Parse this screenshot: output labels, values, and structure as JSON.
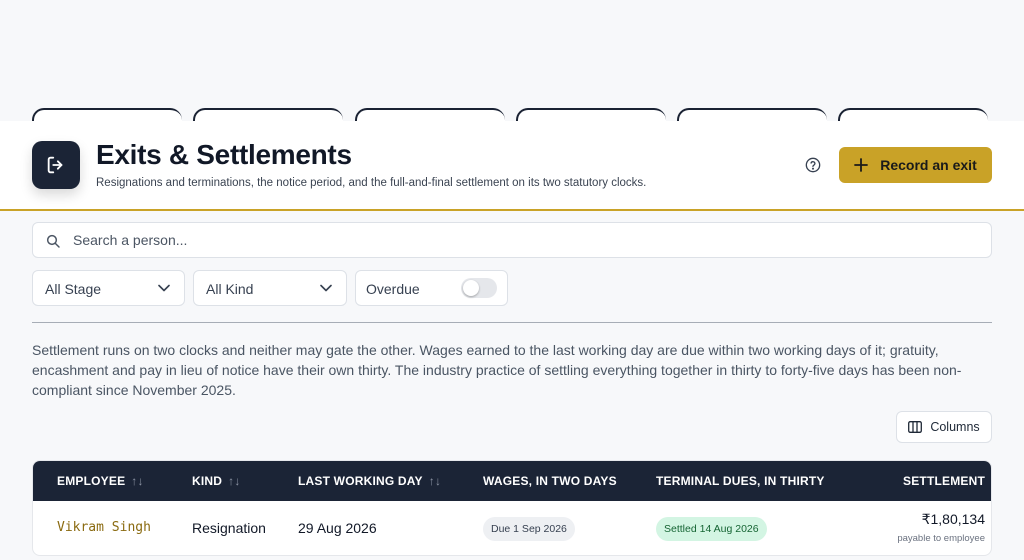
{
  "header": {
    "title": "Exits & Settlements",
    "subtitle": "Resignations and terminations, the notice period, and the full-and-final settlement on its two statutory clocks.",
    "logo_icon": "exit-door-icon",
    "help_icon": "help-circle-icon",
    "primary_action": {
      "label": "Record an exit",
      "icon": "plus-icon"
    }
  },
  "search": {
    "placeholder": "Search a person...",
    "value": ""
  },
  "filters": {
    "stage": {
      "selected": "All Stage"
    },
    "kind": {
      "selected": "All Kind"
    },
    "overdue": {
      "label": "Overdue",
      "on": false
    }
  },
  "notice": "Settlement runs on two clocks and neither may gate the other. Wages earned to the last working day are due within two working days of it; gratuity, encashment and pay in lieu of notice have their own thirty. The industry practice of settling everything together in thirty to forty-five days has been non-compliant since November 2025.",
  "columns_button": {
    "label": "Columns",
    "icon": "columns-icon"
  },
  "table": {
    "headers": {
      "employee": "EMPLOYEE",
      "kind": "KIND",
      "last_working_day": "LAST WORKING DAY",
      "wages": "WAGES, IN TWO DAYS",
      "terminal": "TERMINAL DUES, IN THIRTY",
      "settlement": "SETTLEMENT"
    },
    "sort_glyph": "↑↓",
    "rows": [
      {
        "employee": "Vikram Singh",
        "kind": "Resignation",
        "last_working_day": "29 Aug 2026",
        "wages": "Due 1 Sep 2026",
        "terminal": "Settled 14 Aug 2026",
        "settlement_amount": "₹1,80,134",
        "settlement_note": "payable to employee"
      }
    ]
  },
  "colors": {
    "accent": "#c9a227",
    "dark": "#1b2436",
    "success_bg": "#d3f5e3"
  }
}
